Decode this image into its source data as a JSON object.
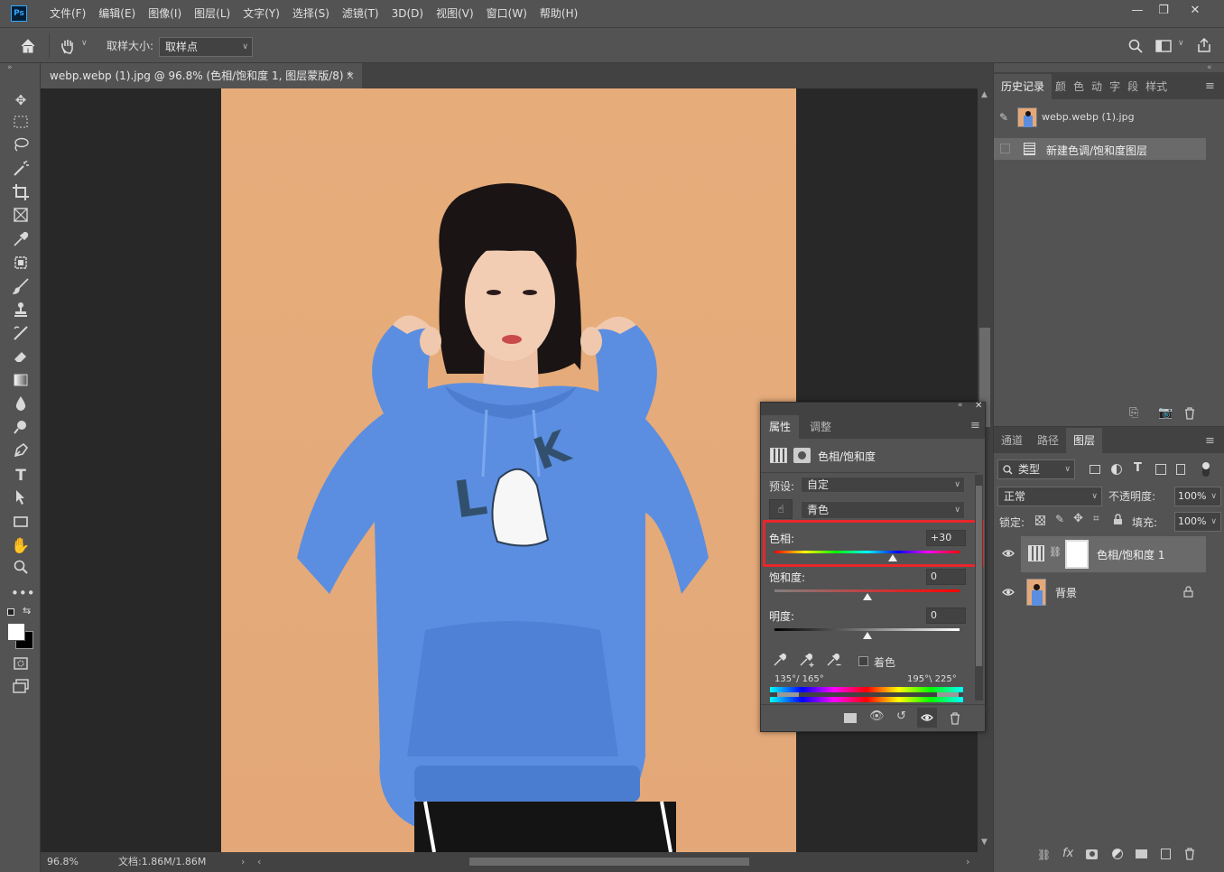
{
  "app": {
    "logo": "Ps"
  },
  "menu": [
    "文件(F)",
    "编辑(E)",
    "图像(I)",
    "图层(L)",
    "文字(Y)",
    "选择(S)",
    "滤镜(T)",
    "3D(D)",
    "视图(V)",
    "窗口(W)",
    "帮助(H)"
  ],
  "window": {
    "minimize": "—",
    "restore": "❐",
    "close": "✕"
  },
  "options": {
    "sample_label": "取样大小:",
    "sample_value": "取样点"
  },
  "document": {
    "tab_title": "webp.webp (1).jpg @ 96.8% (色相/饱和度 1, 图层蒙版/8) *",
    "tab_close": "×"
  },
  "status": {
    "zoom": "96.8%",
    "doc_info": "文档:1.86M/1.86M"
  },
  "history_panel": {
    "tabs": [
      "历史记录",
      "颜",
      "色",
      "动",
      "字",
      "段",
      "样式"
    ],
    "snapshot": "webp.webp (1).jpg",
    "steps": [
      "新建色调/饱和度图层"
    ]
  },
  "layers_panel": {
    "tabs": [
      "通道",
      "路径",
      "图层"
    ],
    "filter_value": "类型",
    "blend_mode": "正常",
    "opacity_label": "不透明度:",
    "opacity_value": "100%",
    "lock_label": "锁定:",
    "fill_label": "填充:",
    "fill_value": "100%",
    "layers": [
      {
        "name": "色相/饱和度 1",
        "visible": true,
        "selected": true
      },
      {
        "name": "背景",
        "visible": true,
        "locked": true
      }
    ]
  },
  "properties_panel": {
    "tabs": [
      "属性",
      "调整"
    ],
    "title": "色相/饱和度",
    "preset_label": "预设:",
    "preset_value": "自定",
    "channel_value": "青色",
    "hue_label": "色相:",
    "hue_value": "+30",
    "hue_position": 0.64,
    "saturation_label": "饱和度:",
    "saturation_value": "0",
    "saturation_position": 0.5,
    "lightness_label": "明度:",
    "lightness_value": "0",
    "lightness_position": 0.5,
    "colorize_label": "着色",
    "range_left": "135°/ 165°",
    "range_right": "195°\\ 225°"
  },
  "colors": {
    "highlight_box": "#e8262b",
    "accent": "#31a8ff"
  }
}
